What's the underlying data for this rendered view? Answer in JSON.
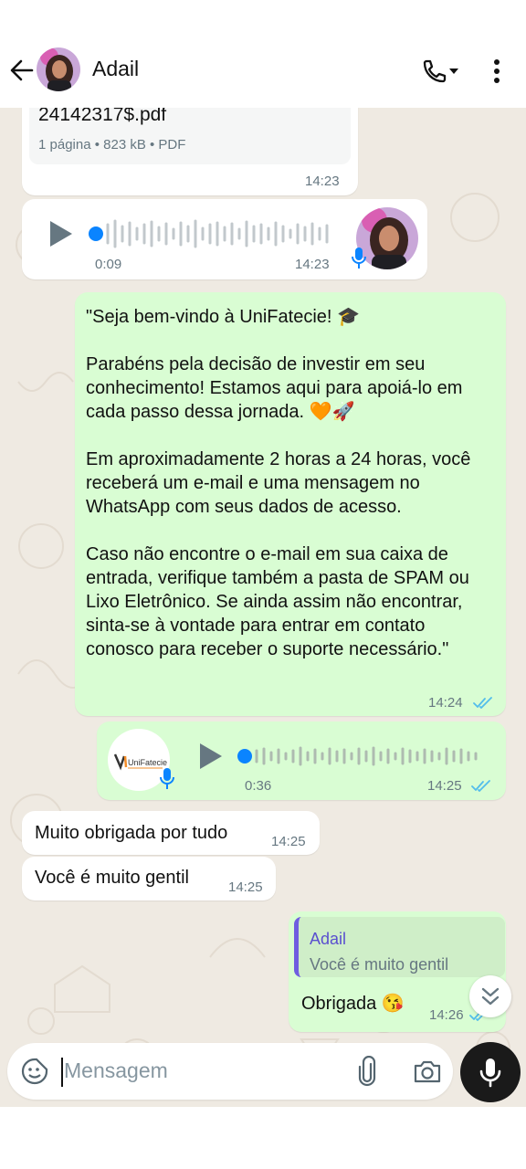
{
  "header": {
    "contact_name": "Adail",
    "icons": [
      "back-arrow-icon",
      "avatar",
      "phone-call-icon",
      "more-vert-icon"
    ]
  },
  "messages": {
    "file": {
      "filename": "24142317$.pdf",
      "meta": "1 página • 823 kB • PDF",
      "time": "14:23"
    },
    "audio_in": {
      "duration": "0:09",
      "time": "14:23"
    },
    "welcome": {
      "text": "\"Seja bem-vindo à UniFatecie! 🎓\n\nParabéns pela decisão de investir em seu conhecimento! Estamos aqui para apoiá-lo em cada passo dessa jornada. 🧡🚀\n\nEm aproximadamente 2 horas a 24 horas, você receberá um e-mail e uma mensagem no WhatsApp com seus dados de acesso.\n\nCaso não encontre o e-mail em sua caixa de entrada, verifique também a pasta de SPAM ou Lixo Eletrônico. Se ainda assim não encontrar, sinta-se à vontade para entrar em contato conosco para receber o suporte necessário.\"",
      "time": "14:24"
    },
    "audio_out": {
      "logo_text": "UniFatecie",
      "duration": "0:36",
      "time": "14:25"
    },
    "thanks": {
      "text": "Muito obrigada por tudo",
      "time": "14:25"
    },
    "gentle": {
      "text": "Você é muito gentil",
      "time": "14:25"
    },
    "reply": {
      "quoted_name": "Adail",
      "quoted_text": "Você é muito gentil",
      "text": "Obrigada 😘",
      "time": "14:26"
    }
  },
  "composer": {
    "placeholder": "Mensagem"
  },
  "colors": {
    "chat_bg": "#efeae2",
    "outgoing": "#d9fdd3",
    "incoming": "#ffffff",
    "tick_blue": "#53bdeb",
    "quote_bar": "#6f5ee0",
    "audio_dot": "#0a84ff"
  }
}
